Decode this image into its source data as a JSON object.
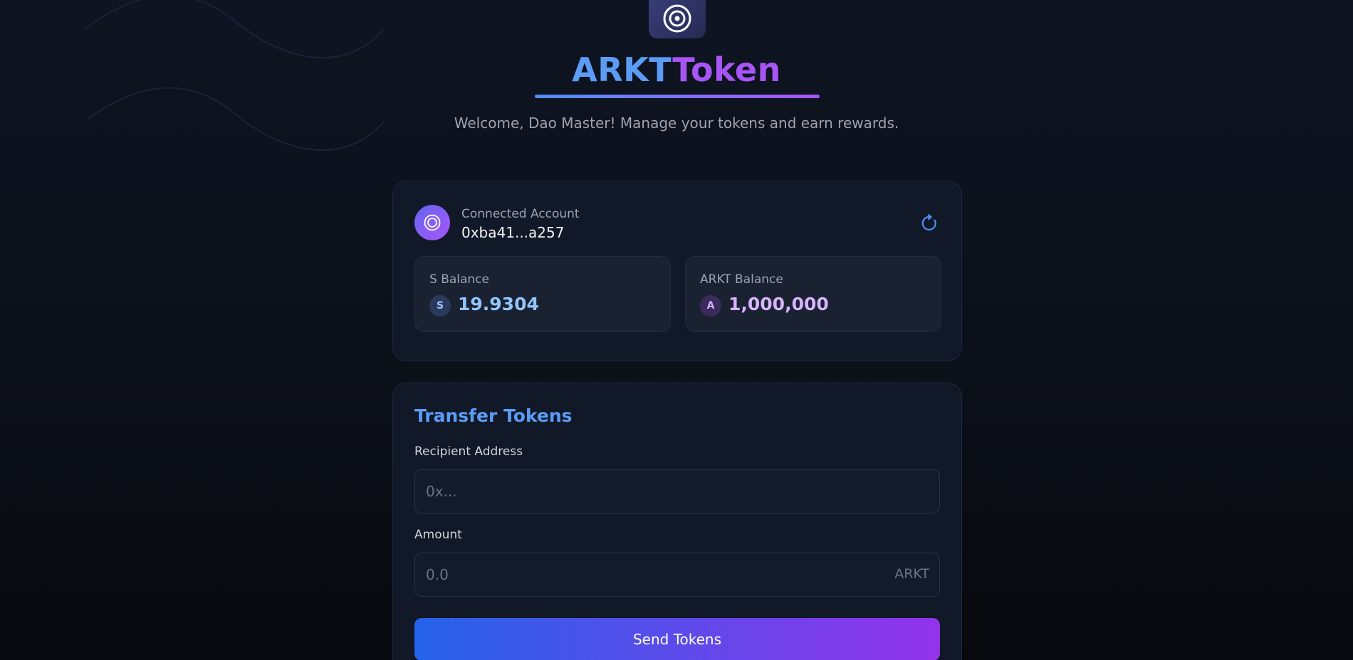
{
  "app": {
    "title_part1": "ARKT",
    "title_part2": "Token",
    "subtitle": "Welcome, Dao Master! Manage your tokens and earn rewards."
  },
  "account": {
    "label": "Connected Account",
    "address": "0xba41...a257"
  },
  "balances": [
    {
      "label": "S Balance",
      "symbol": "S",
      "value": "19.9304"
    },
    {
      "label": "ARKT Balance",
      "symbol": "A",
      "value": "1,000,000"
    }
  ],
  "transfer": {
    "title": "Transfer Tokens",
    "recipient_label": "Recipient Address",
    "recipient_placeholder": "0x...",
    "amount_label": "Amount",
    "amount_placeholder": "0.0",
    "amount_unit": "ARKT",
    "send_label": "Send Tokens"
  },
  "colors": {
    "accent_blue": "#5b9df5",
    "accent_purple": "#a855f7",
    "card_bg": "#111827",
    "page_bg": "#0c1019"
  },
  "icons": {
    "logo": "target-icon",
    "avatar": "target-icon",
    "refresh": "refresh-icon"
  }
}
